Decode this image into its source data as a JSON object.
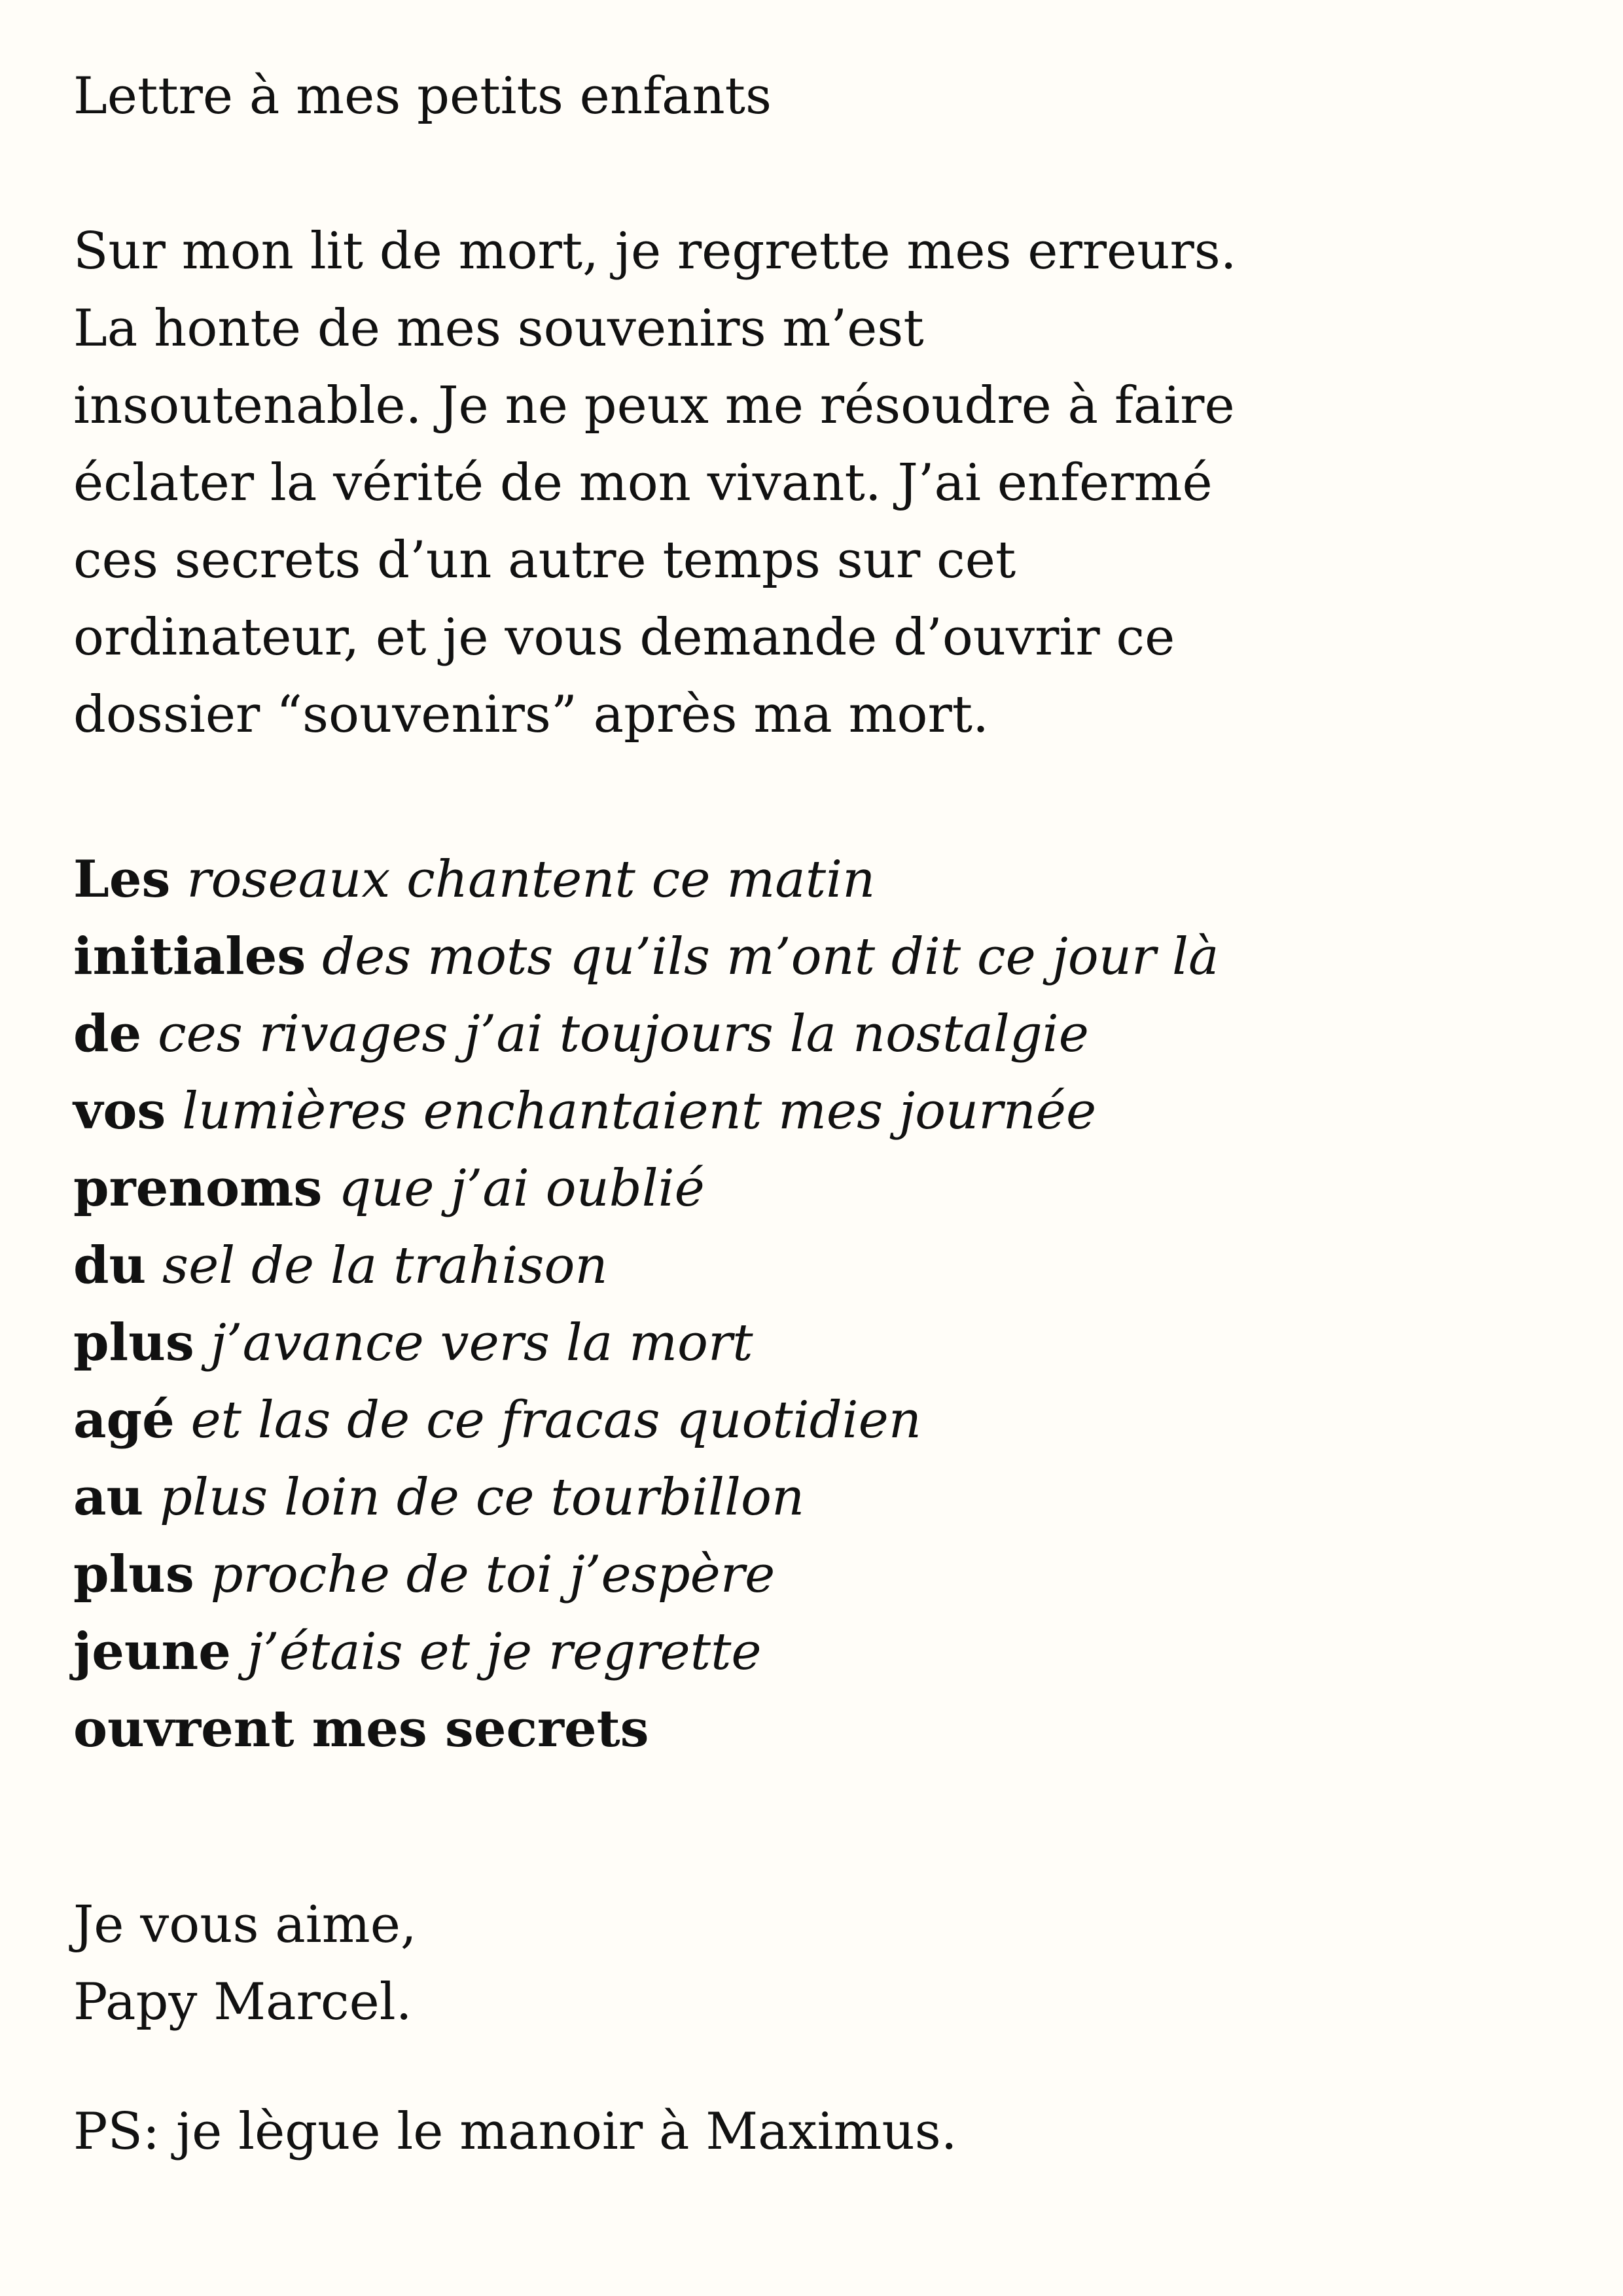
{
  "letter": {
    "title": "Lettre à mes petits enfants",
    "intro_lines": [
      "Sur mon lit de mort, je regrette mes erreurs.",
      "La honte de mes souvenirs m’est",
      "insoutenable. Je ne peux me résoudre à faire",
      "éclater la vérité de mon vivant. J’ai enfermé",
      "ces secrets d’un autre temps sur cet",
      "ordinateur, et je vous demande d’ouvrir ce",
      "dossier “souvenirs” après ma mort."
    ],
    "poem": [
      {
        "bold": "Les",
        "italic": "roseaux chantent ce matin"
      },
      {
        "bold": "initiales",
        "italic": "des mots qu’ils m’ont dit ce jour là"
      },
      {
        "bold": "de",
        "italic": "ces rivages j’ai toujours la nostalgie"
      },
      {
        "bold": "vos",
        "italic": "lumières enchantaient mes journée"
      },
      {
        "bold": "prenoms",
        "italic": "que j’ai oublié"
      },
      {
        "bold": "du",
        "italic": "sel de la trahison"
      },
      {
        "bold": "plus",
        "italic": "j’avance vers la mort"
      },
      {
        "bold": "agé",
        "italic": "et las de ce fracas quotidien"
      },
      {
        "bold": "au",
        "italic": "plus loin de ce tourbillon"
      },
      {
        "bold": "plus",
        "italic": "proche de toi j’espère"
      },
      {
        "bold": "jeune",
        "italic": "j’étais et je regrette"
      },
      {
        "bold": "ouvrent mes secrets",
        "italic": ""
      }
    ],
    "closing_lines": [
      "Je vous aime,",
      "Papy Marcel."
    ],
    "ps": "PS: je lègue le manoir à Maximus."
  }
}
